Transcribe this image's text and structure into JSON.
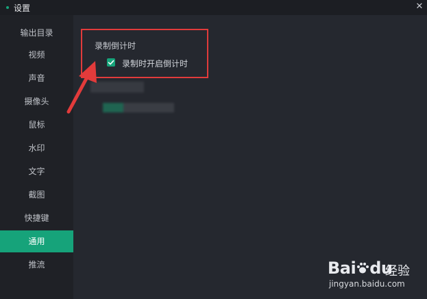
{
  "window": {
    "title": "设置",
    "close_symbol": "✕"
  },
  "sidebar": {
    "items": [
      {
        "label": "输出目录"
      },
      {
        "label": "视频"
      },
      {
        "label": "声音"
      },
      {
        "label": "摄像头"
      },
      {
        "label": "鼠标"
      },
      {
        "label": "水印"
      },
      {
        "label": "文字"
      },
      {
        "label": "截图"
      },
      {
        "label": "快捷键"
      },
      {
        "label": "通用",
        "active": true
      },
      {
        "label": "推流"
      }
    ]
  },
  "general": {
    "section_title": "录制倒计时",
    "countdown_checkbox": {
      "label": "录制时开启倒计时",
      "checked": true
    }
  },
  "watermark": {
    "brand_prefix": "Bai",
    "brand_suffix": "du",
    "brand_cn": "经验",
    "url": "jingyan.baidu.com"
  },
  "colors": {
    "accent": "#16a37a",
    "annotation": "#e23b3b"
  }
}
